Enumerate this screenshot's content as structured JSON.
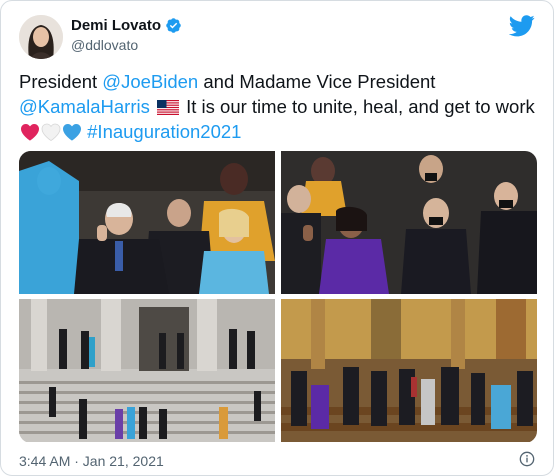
{
  "author": {
    "display_name": "Demi Lovato",
    "handle": "@ddlovato",
    "verified": true
  },
  "tweet": {
    "text_parts": {
      "p1": "President ",
      "mention1": "@JoeBiden",
      "p2": " and Madame Vice President",
      "mention2": "@KamalaHarris",
      "p3": " It is our time to unite, heal, and get to work ",
      "hashtag": "#Inauguration2021"
    },
    "emoji": [
      "us-flag",
      "red-heart",
      "white-heart",
      "blue-heart"
    ]
  },
  "media": {
    "count": 4,
    "photos": [
      "biden-oath",
      "harris-oath",
      "capitol-steps",
      "church-pews"
    ]
  },
  "timestamp": "3:44 AM · Jan 21, 2021",
  "colors": {
    "link": "#1d9bf0",
    "twitter_brand": "#1d9bf0",
    "text": "#0f1419",
    "muted": "#536471",
    "border": "#d6dce1"
  },
  "icons": [
    "twitter-bird-icon",
    "verified-badge-icon",
    "info-icon"
  ]
}
